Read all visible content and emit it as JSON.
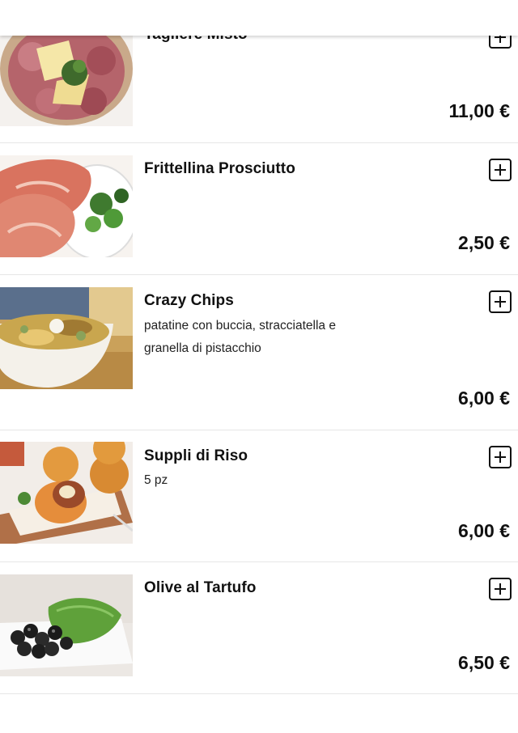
{
  "menu": {
    "items": [
      {
        "name": "Tagliere Misto",
        "description": [],
        "price": "11,00 €",
        "image": "tagliere-image"
      },
      {
        "name": "Frittellina Prosciutto",
        "description": [],
        "price": "2,50 €",
        "image": "prosciutto-image"
      },
      {
        "name": "Crazy Chips",
        "description": [
          "patatine con buccia, stracciatella e",
          "granella di pistacchio"
        ],
        "price": "6,00 €",
        "image": "chips-image"
      },
      {
        "name": "Suppli di Riso",
        "description": [
          "5 pz"
        ],
        "price": "6,00 €",
        "image": "suppli-image"
      },
      {
        "name": "Olive al Tartufo",
        "description": [],
        "price": "6,50 €",
        "image": "olive-image"
      }
    ],
    "add_icon": "plus-square-icon"
  }
}
